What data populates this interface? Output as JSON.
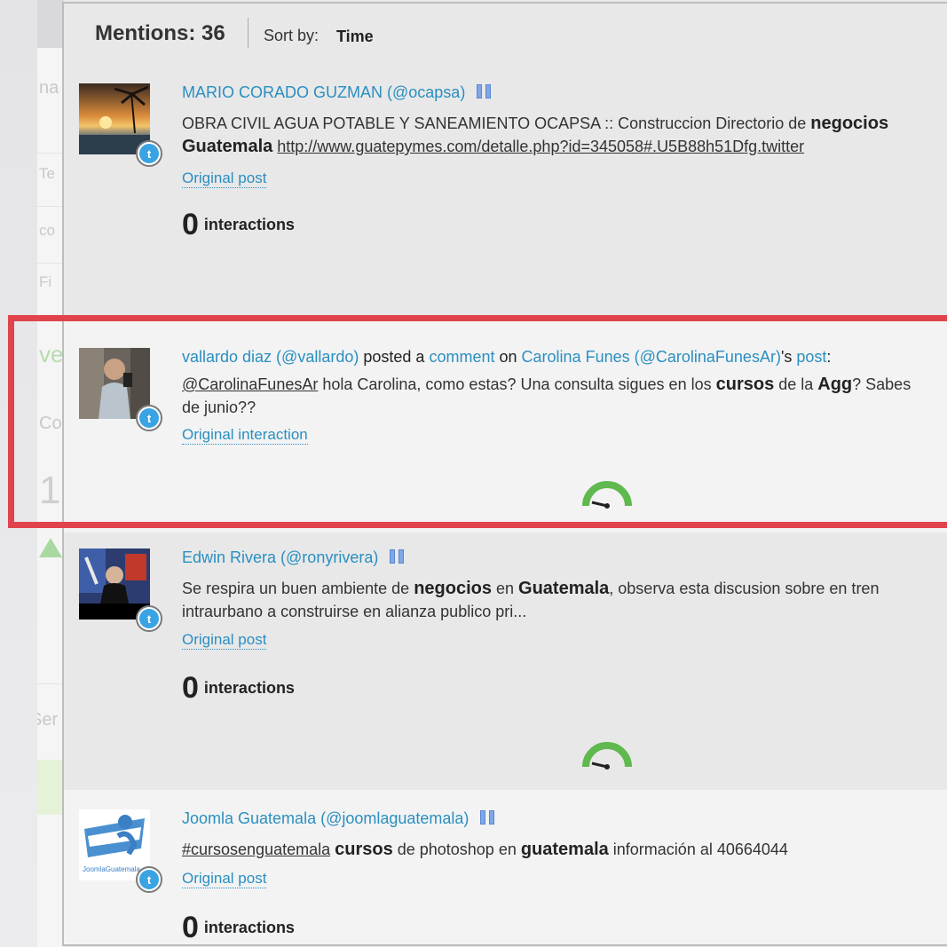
{
  "header": {
    "mentions_label": "Mentions: 36",
    "sort_label": "Sort by:",
    "sort_value": "Time"
  },
  "background_fragments": [
    "na",
    "Te",
    "co",
    "Fi",
    "ve",
    "Co",
    "1",
    "Ser"
  ],
  "mentions": [
    {
      "author": "MARIO CORADO GUZMAN (@ocapsa)",
      "line1_a": "OBRA CIVIL AGUA POTABLE Y SANEAMIENTO OCAPSA :: Construccion Directorio de ",
      "line1_b": "negocios",
      "line2_a": "Guatemala",
      "line2_link": "http://www.guatepymes.com/detalle.php?id=345058#.U5B88h51Dfg.twitter",
      "link_label": "Original post",
      "interactions_count": "0",
      "interactions_label": "interactions",
      "network_icon": "twitter-icon"
    },
    {
      "author": "vallardo diaz (@vallardo)",
      "posted_a": "posted a",
      "comment": "comment",
      "on": "on",
      "target": "Carolina Funes (@CarolinaFunesAr)",
      "possessive": "'s",
      "post": "post",
      "colon": ":",
      "line1_handle": "@CarolinaFunesAr",
      "line1_a": " hola Carolina, como estas? Una consulta sigues en los ",
      "line1_b": "cursos",
      "line1_c": " de la ",
      "line1_d": "Agg",
      "line1_e": "? Sabes",
      "line2": "de junio??",
      "link_label": "Original interaction",
      "network_icon": "twitter-icon"
    },
    {
      "author": "Edwin Rivera (@ronyrivera)",
      "line1_a": "Se respira un buen ambiente de ",
      "line1_b": "negocios",
      "line1_c": " en ",
      "line1_d": "Guatemala",
      "line1_e": ", observa esta discusion sobre en tren",
      "line2": "intraurbano a construirse en alianza publico pri...",
      "link_label": "Original post",
      "interactions_count": "0",
      "interactions_label": "interactions",
      "network_icon": "twitter-icon"
    },
    {
      "author": "Joomla Guatemala (@joomlaguatemala)",
      "line1_hashtag": "#cursosenguatemala",
      "line1_a": " ",
      "line1_b": "cursos",
      "line1_c": " de photoshop en ",
      "line1_d": "guatemala",
      "line1_e": " información al 40664044",
      "avatar_text": "JoomlaGuatemala",
      "link_label": "Original post",
      "interactions_count": "0",
      "interactions_label": "interactions",
      "network_icon": "twitter-icon"
    }
  ],
  "colors": {
    "link": "#2a8fc1",
    "highlight": "#e0434c",
    "gauge": "#5fb94e"
  }
}
